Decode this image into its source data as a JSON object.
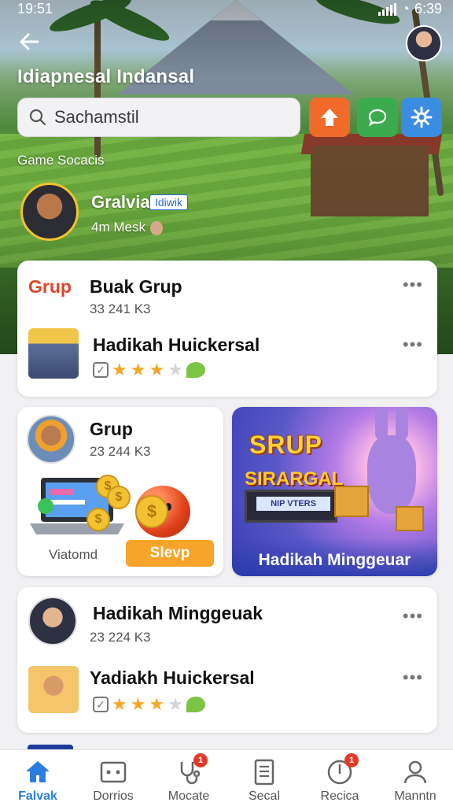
{
  "status_bar": {
    "time": "19:51",
    "battery": "6:39"
  },
  "header": {
    "title": "Idiapnesal Indansal",
    "search_placeholder": "Sachamstil",
    "section_label": "Game Socacis"
  },
  "profile": {
    "name": "Gralvia",
    "badge": "Idiwik",
    "subtitle": "4m Mesk"
  },
  "card_group": {
    "tag": "Grup",
    "title": "Buak Grup",
    "meta": "33 241 K3",
    "item_title": "Hadikah Huickersal",
    "item_rating": 3
  },
  "card_grup2": {
    "title": "Grup",
    "meta": "23 244 K3",
    "label": "Viatomd",
    "button": "Slevp"
  },
  "promo": {
    "headline": "SRUP",
    "sub_headline": "SIRARGAL",
    "screen_text": "NIP VTERS",
    "caption": "Hadikah Minggeuar"
  },
  "card_weekly": {
    "title": "Hadikah Minggeuak",
    "meta": "23 224 K3",
    "item_title": "Yadiakh Huickersal",
    "item_rating": 3
  },
  "nav": {
    "items": [
      {
        "label": "Falvak",
        "icon": "home-icon",
        "active": true,
        "badge": ""
      },
      {
        "label": "Dorrios",
        "icon": "gamepad-icon",
        "active": false,
        "badge": ""
      },
      {
        "label": "Mocate",
        "icon": "stethoscope-icon",
        "active": false,
        "badge": "1"
      },
      {
        "label": "Secal",
        "icon": "document-icon",
        "active": false,
        "badge": ""
      },
      {
        "label": "Recica",
        "icon": "clock-icon",
        "active": false,
        "badge": "1"
      },
      {
        "label": "Manntn",
        "icon": "person-icon",
        "active": false,
        "badge": ""
      }
    ]
  },
  "colors": {
    "accent": "#2a7ee0",
    "home_button": "#f06a2a",
    "chat_button": "#3cab4f",
    "settings_button": "#3a8de0",
    "cta": "#f7a52a",
    "badge": "#e23a2a"
  }
}
